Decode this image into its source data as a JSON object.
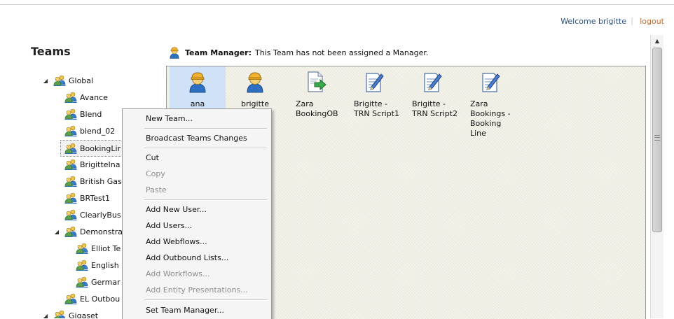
{
  "header": {
    "welcome": "Welcome brigitte",
    "separator": "|",
    "logout": "logout"
  },
  "sidebar": {
    "title": "Teams",
    "tree": [
      {
        "label": "Global",
        "expanded": true
      },
      {
        "label": "Avance"
      },
      {
        "label": "Blend"
      },
      {
        "label": "blend_02"
      },
      {
        "label": "BookingLir",
        "selected": true
      },
      {
        "label": "BrigitteIna"
      },
      {
        "label": "British Gas"
      },
      {
        "label": "BRTest1"
      },
      {
        "label": "ClearlyBus"
      },
      {
        "label": "Demonstra",
        "expanded": true
      },
      {
        "label": "Elliot Te"
      },
      {
        "label": "English"
      },
      {
        "label": "Germar"
      },
      {
        "label": "EL Outbou"
      },
      {
        "label": "Gigaset",
        "expanded": true
      }
    ]
  },
  "manager": {
    "label": "Team Manager:",
    "value": "This Team has not been assigned a Manager."
  },
  "panel": {
    "items": [
      {
        "label": "ana",
        "icon": "user-icon",
        "selected": true
      },
      {
        "label": "brigitte",
        "icon": "user-icon"
      },
      {
        "label": "Zara BookingOB",
        "icon": "outbound-list-icon"
      },
      {
        "label": "Brigitte - TRN Script1",
        "icon": "script-icon"
      },
      {
        "label": "Brigitte - TRN Script2",
        "icon": "script-icon"
      },
      {
        "label": "Zara Bookings - Booking Line",
        "icon": "script-icon"
      }
    ]
  },
  "context_menu": {
    "items": [
      {
        "label": "New Team...",
        "enabled": true
      },
      {
        "label": "Broadcast Teams Changes",
        "enabled": true
      },
      {
        "label": "Cut",
        "enabled": true
      },
      {
        "label": "Copy",
        "enabled": false
      },
      {
        "label": "Paste",
        "enabled": false
      },
      {
        "label": "Add New User...",
        "enabled": true
      },
      {
        "label": "Add Users...",
        "enabled": true
      },
      {
        "label": "Add Webflows...",
        "enabled": true
      },
      {
        "label": "Add Outbound Lists...",
        "enabled": true
      },
      {
        "label": "Add Workflows...",
        "enabled": false
      },
      {
        "label": "Add Entity Presentations...",
        "enabled": false
      },
      {
        "label": "Set Team Manager...",
        "enabled": true
      }
    ]
  },
  "colors": {
    "link": "#2b4f7d",
    "logout": "#c46a2a",
    "selection": "#cfe2f7",
    "panel_bg": "#f4f3ea"
  }
}
